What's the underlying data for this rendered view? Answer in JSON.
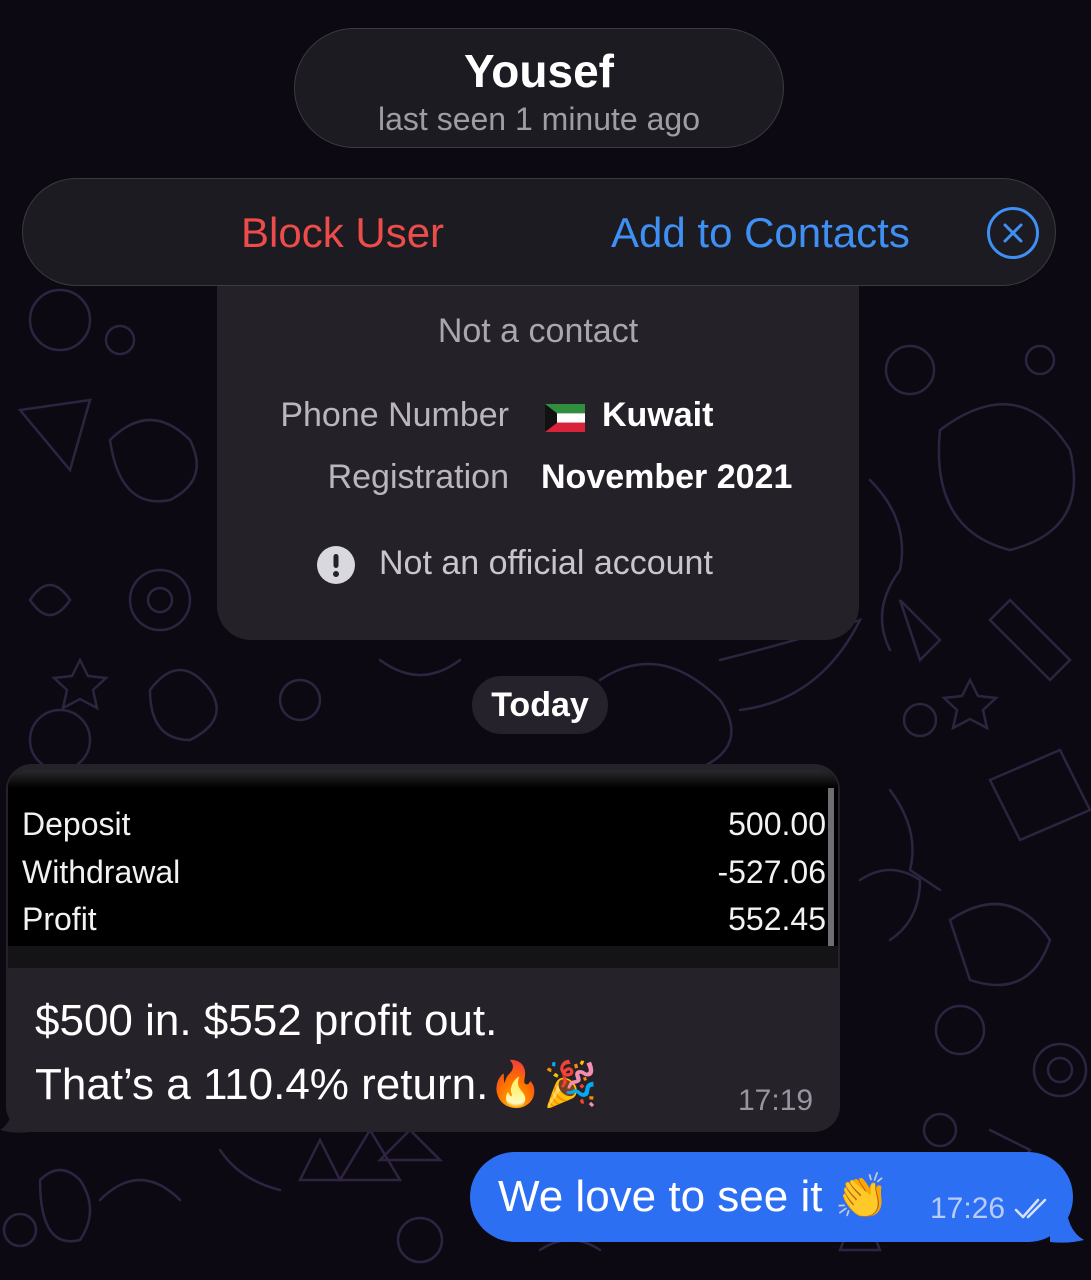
{
  "header": {
    "name": "Yousef",
    "status": "last seen 1 minute ago"
  },
  "action_bar": {
    "block_label": "Block User",
    "add_label": "Add to Contacts",
    "close_icon": "close-circle-icon"
  },
  "info_card": {
    "status": "Not a contact",
    "phone_label": "Phone Number",
    "phone_value": "Kuwait",
    "flag_icon": "kuwait-flag-icon",
    "registration_label": "Registration",
    "registration_value": "November 2021",
    "official_icon": "exclamation-circle-icon",
    "official_text": "Not an official account"
  },
  "date_separator": "Today",
  "incoming_message": {
    "transactions": [
      {
        "label": "Deposit",
        "value": "500.00"
      },
      {
        "label": "Withdrawal",
        "value": "-527.06"
      },
      {
        "label": "Profit",
        "value": "552.45"
      }
    ],
    "line1": "$500 in. $552 profit out.",
    "line2": "That’s a 110.4% return.🔥🎉",
    "time": "17:19"
  },
  "outgoing_message": {
    "text": "We love to see it 👏",
    "time": "17:26",
    "status_icon": "double-check-icon"
  },
  "colors": {
    "background": "#0c0913",
    "block": "#ec4c4a",
    "accent": "#3f90f4",
    "outgoing_bubble": "#2d6ff2",
    "incoming_bubble": "#252229"
  }
}
